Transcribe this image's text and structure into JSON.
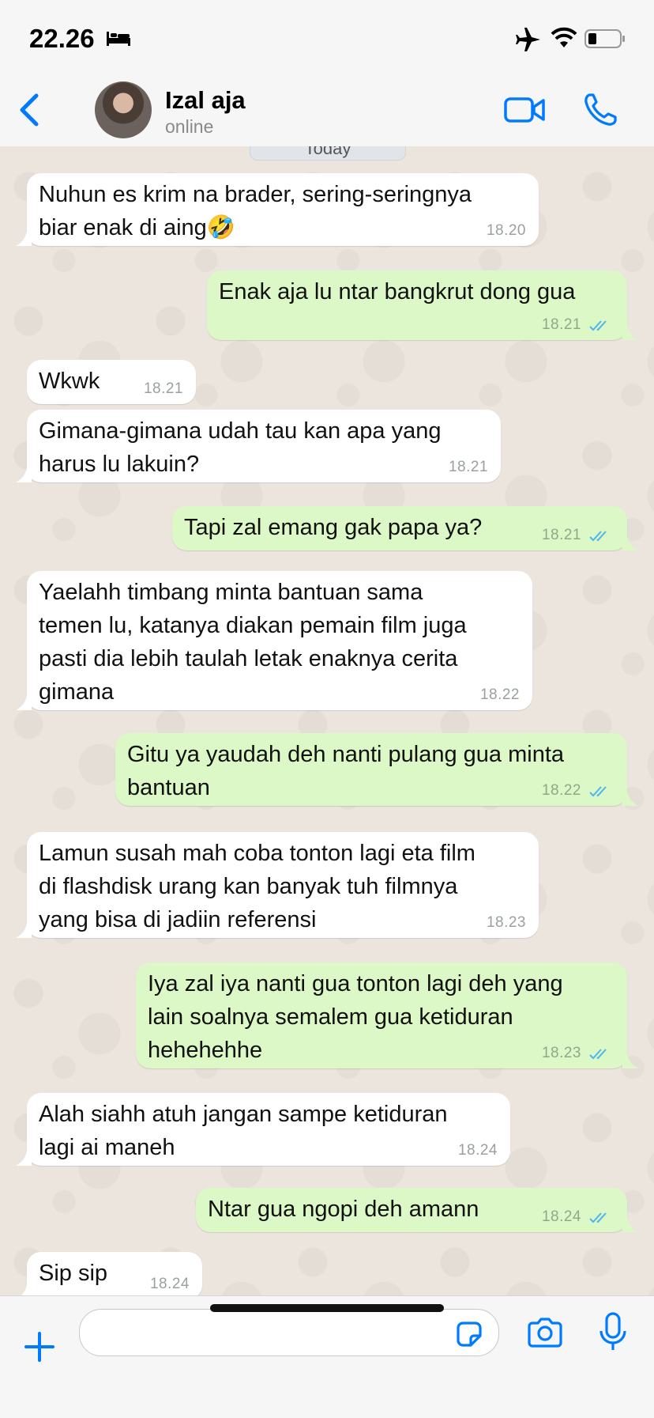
{
  "status_bar": {
    "time": "22.26"
  },
  "header": {
    "contact_name": "Izal aja",
    "presence": "online"
  },
  "date_label": "Today",
  "messages": [
    {
      "text": "Nuhun es krim na brader, sering-seringnya\nbiar enak di aing🤣",
      "time": "18.20",
      "direction": "in"
    },
    {
      "text": "Enak aja lu ntar bangkrut dong gua",
      "time": "18.21",
      "direction": "out"
    },
    {
      "text": "Wkwk",
      "time": "18.21",
      "direction": "in"
    },
    {
      "text": "Gimana-gimana udah tau kan apa yang\nharus lu lakuin?",
      "time": "18.21",
      "direction": "in"
    },
    {
      "text": "Tapi zal emang gak papa ya?",
      "time": "18.21",
      "direction": "out"
    },
    {
      "text": "Yaelahh timbang minta bantuan sama\ntemen lu, katanya diakan pemain film juga\npasti dia lebih taulah letak enaknya cerita\ngimana",
      "time": "18.22",
      "direction": "in"
    },
    {
      "text": "Gitu ya yaudah deh nanti pulang gua minta\nbantuan",
      "time": "18.22",
      "direction": "out"
    },
    {
      "text": "Lamun susah mah coba tonton lagi eta film\ndi flashdisk urang kan banyak tuh filmnya\nyang bisa di jadiin referensi",
      "time": "18.23",
      "direction": "in"
    },
    {
      "text": "Iya zal iya nanti gua tonton lagi deh yang\nlain soalnya semalem gua ketiduran\nhehehehhe",
      "time": "18.23",
      "direction": "out"
    },
    {
      "text": "Alah siahh atuh jangan sampe ketiduran\nlagi ai maneh",
      "time": "18.24",
      "direction": "in"
    },
    {
      "text": "Ntar gua ngopi deh amann",
      "time": "18.24",
      "direction": "out"
    },
    {
      "text": "Sip sip",
      "time": "18.24",
      "direction": "in"
    }
  ],
  "composer": {
    "placeholder": ""
  },
  "icons": {
    "status": [
      "bed-icon",
      "airplane-icon",
      "wifi-icon",
      "battery-icon"
    ],
    "header": [
      "back-chevron-icon",
      "video-call-icon",
      "phone-icon"
    ],
    "composer": [
      "plus-icon",
      "sticker-icon",
      "camera-icon",
      "microphone-icon"
    ]
  },
  "colors": {
    "accent": "#007AFF",
    "outgoing_bubble": "#DCF8C6",
    "incoming_bubble": "#FFFFFF",
    "read_ticks": "#4FB6EC",
    "chat_background": "#ECE5DD"
  }
}
